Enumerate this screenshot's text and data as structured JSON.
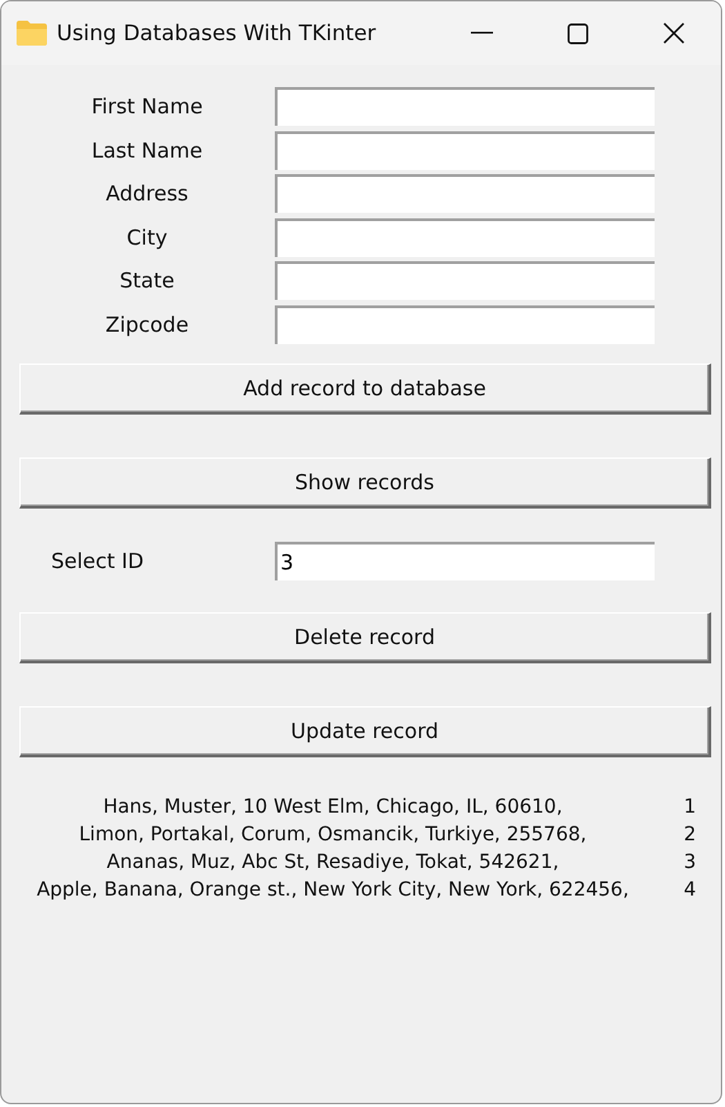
{
  "window": {
    "title": "Using Databases With TKinter"
  },
  "fields": [
    {
      "label": "First Name"
    },
    {
      "label": "Last Name"
    },
    {
      "label": "Address"
    },
    {
      "label": "City"
    },
    {
      "label": "State"
    },
    {
      "label": "Zipcode"
    }
  ],
  "add_button": "Add record to database",
  "show_button": "Show records",
  "select_id": {
    "label": "Select ID",
    "value": "3"
  },
  "delete_button": "Delete record",
  "update_button": "Update record",
  "records": [
    {
      "text": "Hans, Muster, 10 West Elm, Chicago, IL, 60610,",
      "id": "1"
    },
    {
      "text": "Limon, Portakal, Corum, Osmancik, Turkiye, 255768,",
      "id": "2"
    },
    {
      "text": "Ananas, Muz, Abc St, Resadiye, Tokat, 542621,",
      "id": "3"
    },
    {
      "text": "Apple, Banana, Orange st., New York City, New York, 622456,",
      "id": "4"
    }
  ]
}
